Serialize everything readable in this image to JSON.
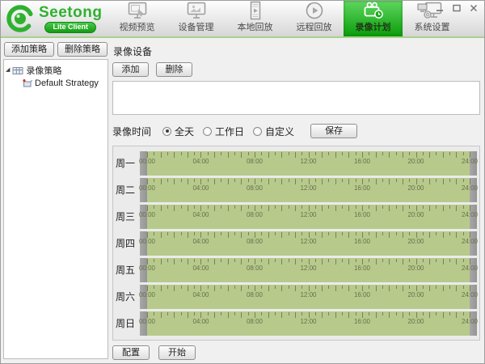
{
  "colors": {
    "accent_green": "#2fb12f",
    "nav_selected_top": "#5fd75f",
    "nav_selected_bottom": "#0b9c0b",
    "timeline_green": "#b7ca8b",
    "handle_gray": "#9a9a9a"
  },
  "logo": {
    "title": "Seetong",
    "badge": "Lite Client"
  },
  "titlebar": {
    "controls": [
      {
        "id": "pin",
        "icon": "monitor-small-icon"
      },
      {
        "id": "minimize",
        "icon": "minimize-icon"
      },
      {
        "id": "maximize",
        "icon": "maximize-icon"
      },
      {
        "id": "close",
        "icon": "close-icon"
      }
    ]
  },
  "nav": {
    "items": [
      {
        "id": "video-preview",
        "label": "视频预览",
        "icon": "video-preview-icon",
        "active": false
      },
      {
        "id": "device-management",
        "label": "设备管理",
        "icon": "device-management-icon",
        "active": false
      },
      {
        "id": "local-playback",
        "label": "本地回放",
        "icon": "local-playback-icon",
        "active": false
      },
      {
        "id": "remote-playback",
        "label": "远程回放",
        "icon": "remote-playback-icon",
        "active": false
      },
      {
        "id": "record-plan",
        "label": "录像计划",
        "icon": "record-plan-icon",
        "active": true
      },
      {
        "id": "system-settings",
        "label": "系统设置",
        "icon": "system-settings-icon",
        "active": false
      }
    ]
  },
  "sidebar": {
    "add_strategy_label": "添加策略",
    "delete_strategy_label": "删除策略",
    "tree": {
      "root_label": "录像策略",
      "children": [
        {
          "label": "Default Strategy"
        }
      ]
    }
  },
  "main": {
    "device_section": {
      "title": "录像设备",
      "add_label": "添加",
      "delete_label": "删除",
      "devices": []
    },
    "time_section": {
      "label": "录像时间",
      "options": [
        {
          "label": "全天",
          "selected": true
        },
        {
          "label": "工作日",
          "selected": false
        },
        {
          "label": "自定义",
          "selected": false
        }
      ],
      "save_label": "保存"
    },
    "schedule": {
      "days": [
        "周一",
        "周二",
        "周三",
        "周四",
        "周五",
        "周六",
        "周日"
      ],
      "time_labels": [
        "00:00",
        "04:00",
        "08:00",
        "12:00",
        "16:00",
        "20:00",
        "24:00"
      ],
      "hours_span": 24,
      "selected_range_per_day": {
        "start": "00:00",
        "end": "24:00"
      }
    },
    "actions": {
      "config_label": "配置",
      "start_label": "开始"
    }
  }
}
